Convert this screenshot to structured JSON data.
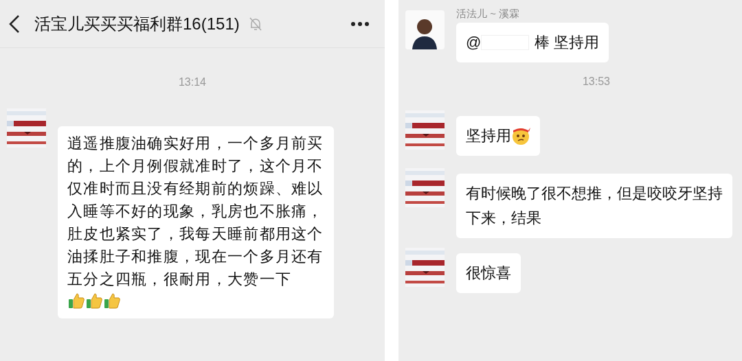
{
  "left_chat": {
    "header": {
      "title": "活宝儿买买买福利群16(151)",
      "muted": true
    },
    "messages": [
      {
        "kind": "time",
        "text": "13:14"
      },
      {
        "kind": "message",
        "avatar": {
          "kind": "picture"
        },
        "parts": [
          {
            "kind": "text",
            "text": "逍遥推腹油确实好用，一个多月前买的，上个月例假就准时了，这个月不仅准时而且没有经期前的烦躁、难以入睡等不好的现象，乳房也不胀痛，肚皮也紧实了，我每天睡前都用这个油揉肚子和推腹，现在一个多月还有五分之四瓶，很耐用，大赞一下"
          },
          {
            "kind": "thumbs_up"
          },
          {
            "kind": "thumbs_up"
          },
          {
            "kind": "thumbs_up"
          }
        ]
      }
    ]
  },
  "right_chat": {
    "messages": [
      {
        "kind": "message",
        "avatar": {
          "kind": "figure"
        },
        "sender": "活法儿 ~ 溪霖",
        "parts": [
          {
            "kind": "text",
            "text": "@"
          },
          {
            "kind": "redacted"
          },
          {
            "kind": "text",
            "text": "棒  坚持用"
          }
        ]
      },
      {
        "kind": "time",
        "text": "13:53"
      },
      {
        "kind": "message",
        "avatar": {
          "kind": "picture"
        },
        "parts": [
          {
            "kind": "text",
            "text": "坚持用"
          },
          {
            "kind": "determined_face"
          }
        ]
      },
      {
        "kind": "message",
        "avatar": {
          "kind": "picture"
        },
        "parts": [
          {
            "kind": "text",
            "text": "有时候晚了很不想推，但是咬咬牙坚持下来，结果"
          }
        ]
      },
      {
        "kind": "message",
        "avatar": {
          "kind": "picture"
        },
        "parts": [
          {
            "kind": "text",
            "text": "很惊喜"
          }
        ]
      }
    ]
  }
}
